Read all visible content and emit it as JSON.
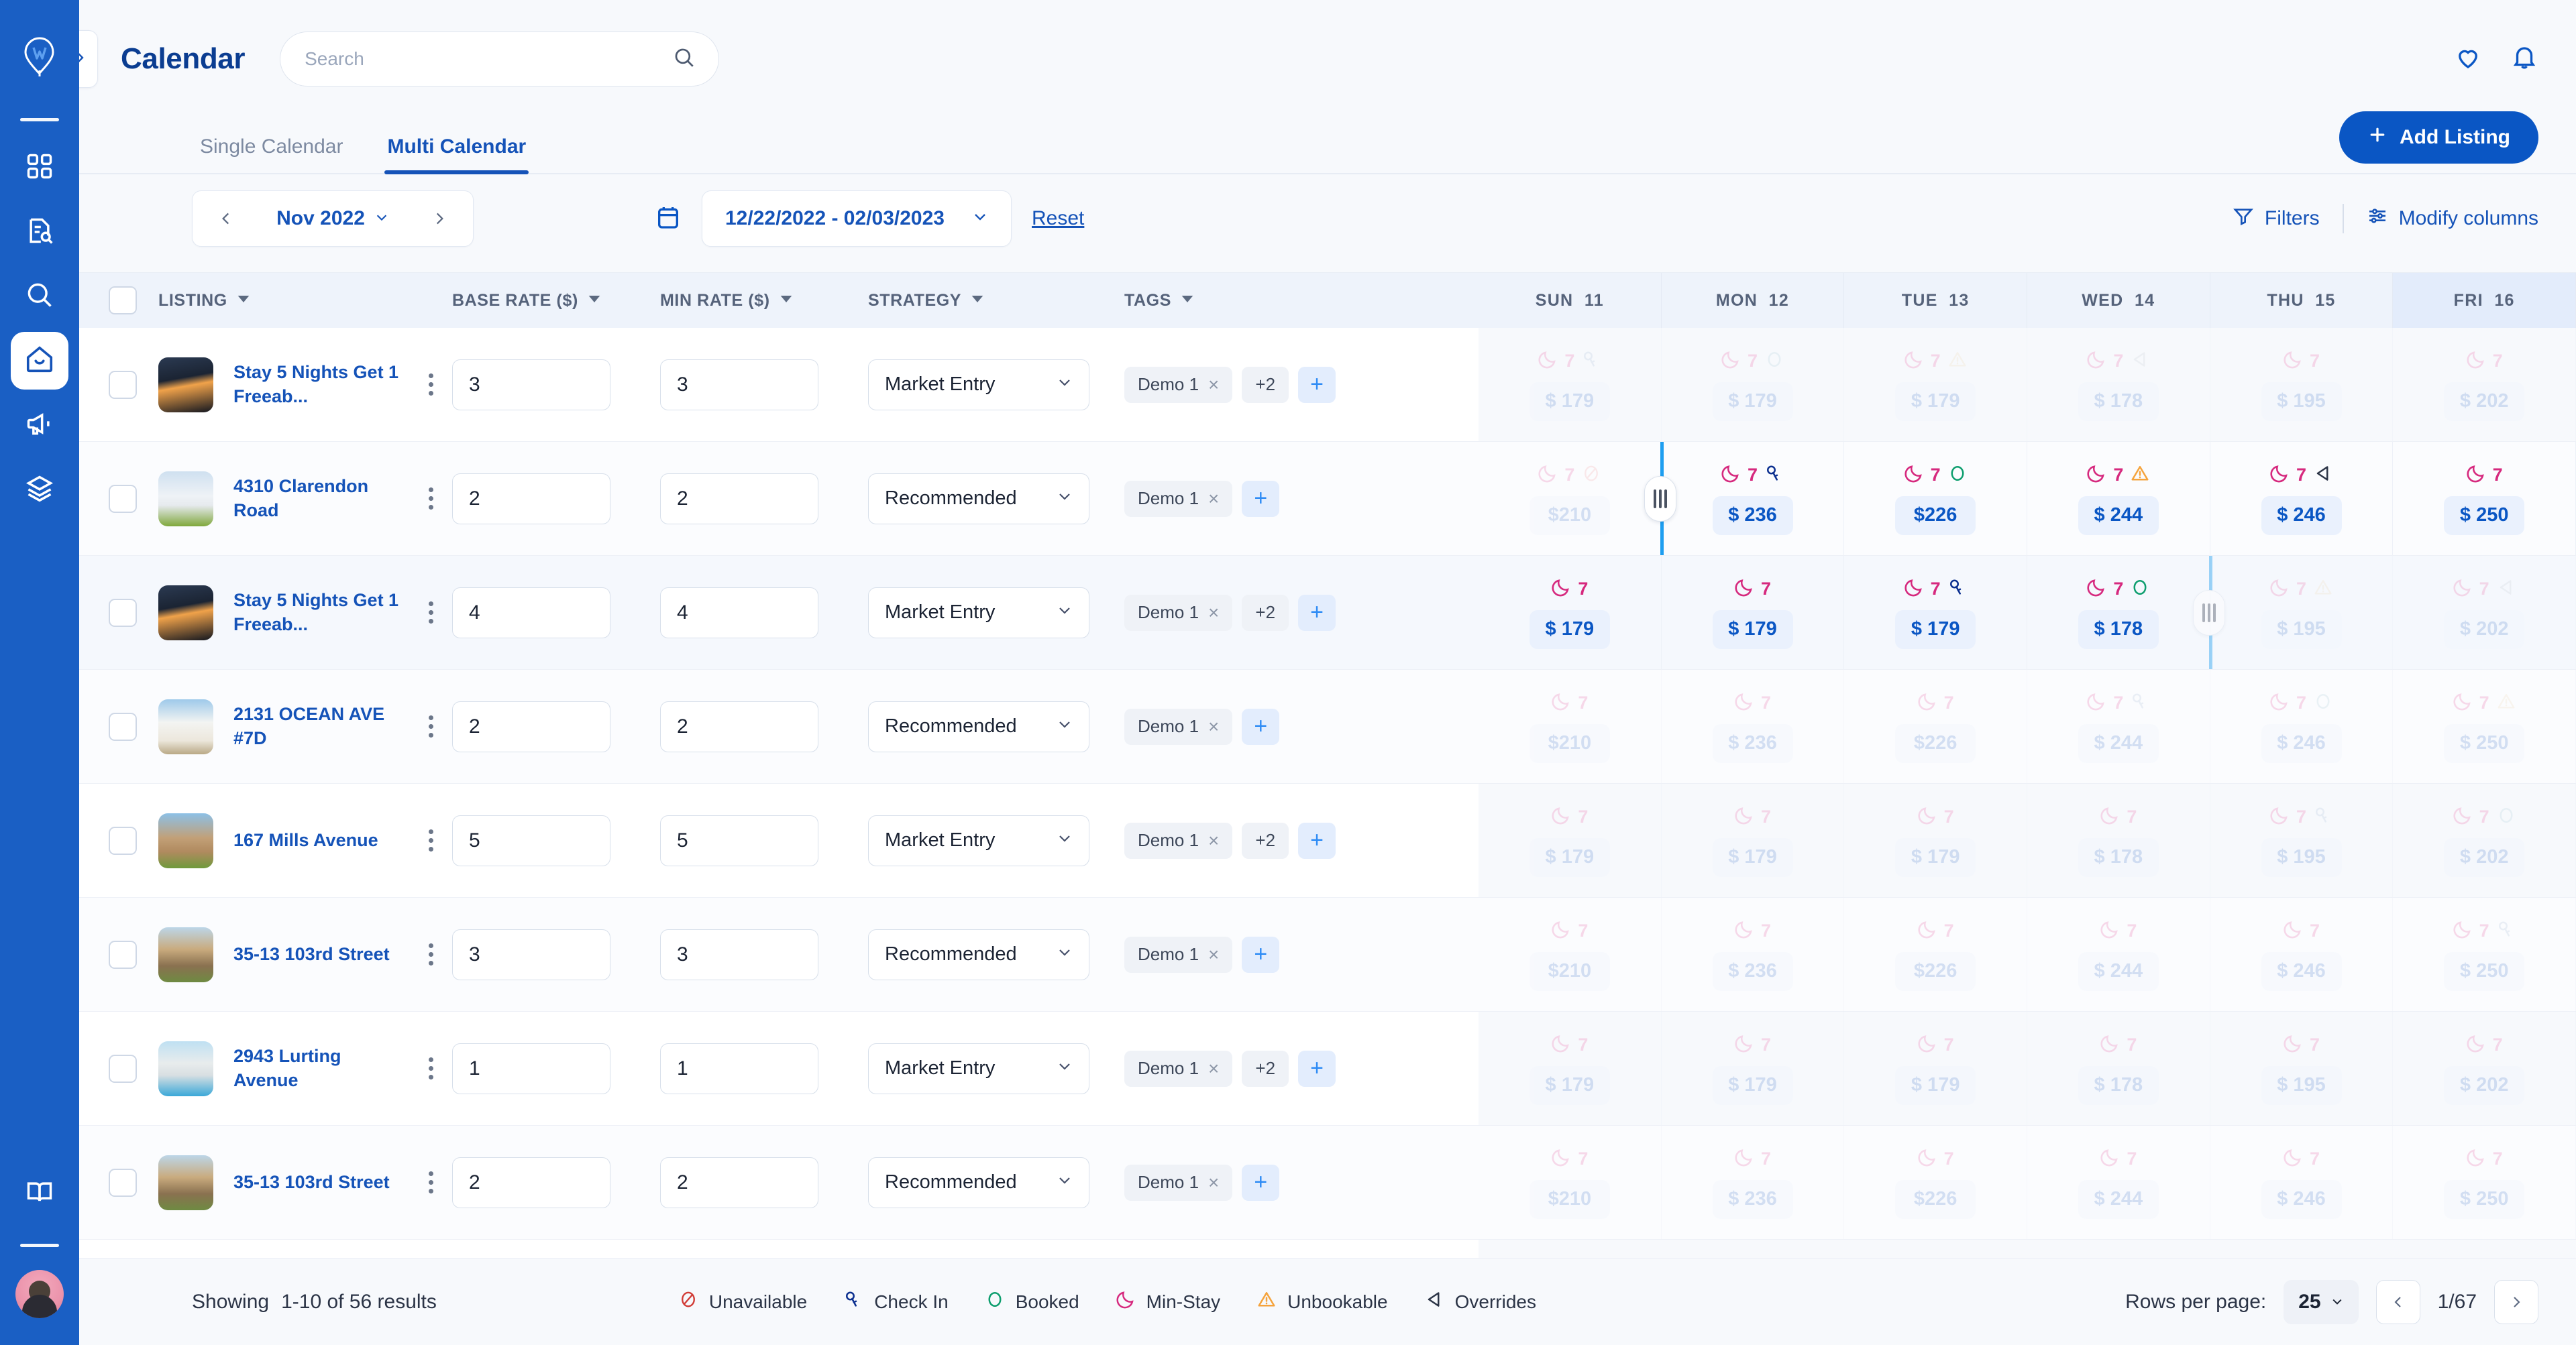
{
  "app": {
    "brand_color": "#1a5fc4",
    "accent_color": "#0a56c4",
    "logo_name": "location-pin-logo"
  },
  "sidebar": {
    "items": [
      {
        "icon": "grid-dashboard-icon",
        "active": false
      },
      {
        "icon": "document-search-icon",
        "active": false
      },
      {
        "icon": "magnifier-icon",
        "active": false
      },
      {
        "icon": "home-smile-icon",
        "active": true
      },
      {
        "icon": "megaphone-icon",
        "active": false
      },
      {
        "icon": "layers-stack-icon",
        "active": false
      },
      {
        "icon": "open-book-icon",
        "active": false
      }
    ],
    "avatar_label": "user-avatar"
  },
  "header": {
    "title": "Calendar",
    "collapse_icon": "chevron-right-icon",
    "search": {
      "placeholder": "Search",
      "value": "",
      "icon": "search-icon"
    },
    "favorites_icon": "heart-icon",
    "notifications_icon": "bell-icon"
  },
  "tabs": [
    {
      "label": "Single Calendar",
      "active": false
    },
    {
      "label": "Multi Calendar",
      "active": true
    }
  ],
  "add_listing": {
    "label": "Add Listing",
    "icon": "plus-icon"
  },
  "toolbar": {
    "prev_icon": "chevron-left-icon",
    "next_icon": "chevron-right-icon",
    "month": "Nov 2022",
    "month_caret": "chevron-down-icon",
    "calendar_icon": "calendar-icon",
    "date_range": "12/22/2022  -  02/03/2023",
    "date_caret": "chevron-down-icon",
    "reset": "Reset",
    "filters": {
      "label": "Filters",
      "icon": "funnel-icon"
    },
    "modify_columns": {
      "label": "Modify columns",
      "icon": "sliders-icon"
    }
  },
  "table": {
    "columns": [
      {
        "key": "listing",
        "label": "LISTING",
        "sortable": true
      },
      {
        "key": "base_rate",
        "label": "BASE RATE ($)",
        "sortable": true
      },
      {
        "key": "min_rate",
        "label": "MIN RATE ($)",
        "sortable": true
      },
      {
        "key": "strategy",
        "label": "STRATEGY",
        "sortable": true
      },
      {
        "key": "tags",
        "label": "TAGS",
        "sortable": true
      }
    ],
    "strategy_options": [
      "Market Entry",
      "Recommended"
    ],
    "rows": [
      {
        "name": "Stay 5 Nights Get 1 Freeab...",
        "thumb": "night-modern-house",
        "base_rate": "3",
        "min_rate": "3",
        "strategy": "Market Entry",
        "tags": [
          "Demo 1"
        ],
        "more_tags": "+2"
      },
      {
        "name": "4310 Clarendon Road",
        "thumb": "white-victorian-house",
        "base_rate": "2",
        "min_rate": "2",
        "strategy": "Recommended",
        "tags": [
          "Demo 1"
        ],
        "more_tags": ""
      },
      {
        "name": "Stay 5 Nights Get 1 Freeab...",
        "thumb": "night-modern-house",
        "base_rate": "4",
        "min_rate": "4",
        "strategy": "Market Entry",
        "tags": [
          "Demo 1"
        ],
        "more_tags": "+2"
      },
      {
        "name": "2131 OCEAN AVE #7D",
        "thumb": "white-modern-villa",
        "base_rate": "2",
        "min_rate": "2",
        "strategy": "Recommended",
        "tags": [
          "Demo 1"
        ],
        "more_tags": ""
      },
      {
        "name": "167 Mills Avenue",
        "thumb": "brick-suburban-house",
        "base_rate": "5",
        "min_rate": "5",
        "strategy": "Market Entry",
        "tags": [
          "Demo 1"
        ],
        "more_tags": "+2"
      },
      {
        "name": "35-13 103rd Street",
        "thumb": "tan-craftsman-house",
        "base_rate": "3",
        "min_rate": "3",
        "strategy": "Recommended",
        "tags": [
          "Demo 1"
        ],
        "more_tags": ""
      },
      {
        "name": "2943 Lurting Avenue",
        "thumb": "pool-modern-house",
        "base_rate": "1",
        "min_rate": "1",
        "strategy": "Market Entry",
        "tags": [
          "Demo 1"
        ],
        "more_tags": "+2"
      },
      {
        "name": "35-13 103rd Street",
        "thumb": "tan-craftsman-house",
        "base_rate": "2",
        "min_rate": "2",
        "strategy": "Recommended",
        "tags": [
          "Demo 1"
        ],
        "more_tags": ""
      }
    ],
    "tag_remove_icon": "x-icon",
    "tag_add_icon": "plus-icon"
  },
  "calendar": {
    "days": [
      {
        "dow": "SUN",
        "num": "11",
        "highlight": false
      },
      {
        "dow": "MON",
        "num": "12",
        "highlight": false
      },
      {
        "dow": "TUE",
        "num": "13",
        "highlight": false
      },
      {
        "dow": "WED",
        "num": "14",
        "highlight": false
      },
      {
        "dow": "THU",
        "num": "15",
        "highlight": false
      },
      {
        "dow": "FRI",
        "num": "16",
        "highlight": true
      }
    ],
    "min_stay_value": "7",
    "rows": [
      {
        "dim": true,
        "cells": [
          {
            "price": "$ 179",
            "badge": "check-in-icon"
          },
          {
            "price": "$ 179",
            "badge": "booked-icon"
          },
          {
            "price": "$ 179",
            "badge": "unbookable-icon"
          },
          {
            "price": "$ 178",
            "badge": "overrides-icon"
          },
          {
            "price": "$ 195",
            "badge": ""
          },
          {
            "price": "$ 202",
            "badge": ""
          }
        ]
      },
      {
        "dim": false,
        "cells": [
          {
            "price": "$210",
            "badge": "unavailable-icon",
            "dim": true
          },
          {
            "price": "$ 236",
            "badge": "check-in-icon"
          },
          {
            "price": "$226",
            "badge": "booked-icon"
          },
          {
            "price": "$ 244",
            "badge": "unbookable-icon"
          },
          {
            "price": "$ 246",
            "badge": "overrides-icon"
          },
          {
            "price": "$ 250",
            "badge": ""
          }
        ]
      },
      {
        "dim": false,
        "cells": [
          {
            "price": "$ 179",
            "badge": ""
          },
          {
            "price": "$ 179",
            "badge": ""
          },
          {
            "price": "$ 179",
            "badge": "check-in-icon"
          },
          {
            "price": "$ 178",
            "badge": "booked-icon"
          },
          {
            "price": "$ 195",
            "badge": "unbookable-icon",
            "dim": true
          },
          {
            "price": "$ 202",
            "badge": "overrides-icon",
            "dim": true
          }
        ]
      },
      {
        "dim": true,
        "cells": [
          {
            "price": "$210",
            "badge": ""
          },
          {
            "price": "$ 236",
            "badge": ""
          },
          {
            "price": "$226",
            "badge": ""
          },
          {
            "price": "$ 244",
            "badge": "check-in-icon"
          },
          {
            "price": "$ 246",
            "badge": "booked-icon"
          },
          {
            "price": "$ 250",
            "badge": "unbookable-icon"
          }
        ]
      },
      {
        "dim": true,
        "cells": [
          {
            "price": "$ 179",
            "badge": ""
          },
          {
            "price": "$ 179",
            "badge": ""
          },
          {
            "price": "$ 179",
            "badge": ""
          },
          {
            "price": "$ 178",
            "badge": ""
          },
          {
            "price": "$ 195",
            "badge": "check-in-icon"
          },
          {
            "price": "$ 202",
            "badge": "booked-icon"
          }
        ]
      },
      {
        "dim": true,
        "cells": [
          {
            "price": "$210",
            "badge": ""
          },
          {
            "price": "$ 236",
            "badge": ""
          },
          {
            "price": "$226",
            "badge": ""
          },
          {
            "price": "$ 244",
            "badge": ""
          },
          {
            "price": "$ 246",
            "badge": ""
          },
          {
            "price": "$ 250",
            "badge": "check-in-icon"
          }
        ]
      },
      {
        "dim": true,
        "cells": [
          {
            "price": "$ 179",
            "badge": ""
          },
          {
            "price": "$ 179",
            "badge": ""
          },
          {
            "price": "$ 179",
            "badge": ""
          },
          {
            "price": "$ 178",
            "badge": ""
          },
          {
            "price": "$ 195",
            "badge": ""
          },
          {
            "price": "$ 202",
            "badge": ""
          }
        ]
      },
      {
        "dim": true,
        "cells": [
          {
            "price": "$210",
            "badge": ""
          },
          {
            "price": "$ 236",
            "badge": ""
          },
          {
            "price": "$226",
            "badge": ""
          },
          {
            "price": "$ 244",
            "badge": ""
          },
          {
            "price": "$ 246",
            "badge": ""
          },
          {
            "price": "$ 250",
            "badge": ""
          }
        ]
      }
    ]
  },
  "footer": {
    "showing_label": "Showing",
    "showing_value": "1-10 of 56 results",
    "legend": [
      {
        "label": "Unavailable",
        "icon": "unavailable-icon",
        "color": "#d13b35"
      },
      {
        "label": "Check In",
        "icon": "check-in-icon",
        "color": "#0b2f8f"
      },
      {
        "label": "Booked",
        "icon": "booked-icon",
        "color": "#0d9e6e"
      },
      {
        "label": "Min-Stay",
        "icon": "moon-icon",
        "color": "#d6297e"
      },
      {
        "label": "Unbookable",
        "icon": "unbookable-icon",
        "color": "#f5a33c"
      },
      {
        "label": "Overrides",
        "icon": "overrides-icon",
        "color": "#2b3446"
      }
    ],
    "rows_per_page_label": "Rows per page:",
    "rows_per_page_value": "25",
    "page_indicator": "1/67",
    "prev_icon": "chevron-left-icon",
    "next_icon": "chevron-right-icon"
  }
}
